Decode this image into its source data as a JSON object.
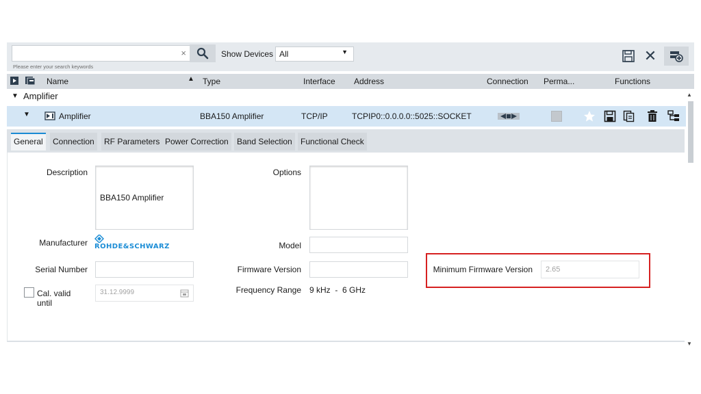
{
  "toolbar": {
    "search_placeholder": "",
    "search_hint": "Please enter your search keywords",
    "clear_glyph": "×",
    "show_devices_label": "Show Devices",
    "show_devices_value": "All",
    "close_glyph": "✕"
  },
  "columns": {
    "name": "Name",
    "type": "Type",
    "interface": "Interface",
    "address": "Address",
    "connection": "Connection",
    "permanent": "Perma...",
    "functions": "Functions"
  },
  "group": {
    "label": "Amplifier"
  },
  "device": {
    "name": "Amplifier",
    "type": "BBA150 Amplifier",
    "interface": "TCP/IP",
    "address": "TCPIP0::0.0.0.0::5025::SOCKET"
  },
  "tabs": [
    {
      "label": "General"
    },
    {
      "label": "Connection"
    },
    {
      "label": "RF Parameters"
    },
    {
      "label": "Power Correction"
    },
    {
      "label": "Band Selection"
    },
    {
      "label": "Functional Check"
    }
  ],
  "general": {
    "description_label": "Description",
    "description_value": "BBA150 Amplifier",
    "options_label": "Options",
    "options_value": "",
    "manufacturer_label": "Manufacturer",
    "manufacturer_logo_text": "ROHDE&SCHWARZ",
    "model_label": "Model",
    "model_value": "",
    "serial_label": "Serial Number",
    "serial_value": "",
    "firmware_label": "Firmware Version",
    "firmware_value": "",
    "min_firmware_label": "Minimum Firmware Version",
    "min_firmware_value": "2.65",
    "cal_label": "Cal. valid until",
    "cal_value": "31.12.9999",
    "freq_label": "Frequency Range",
    "freq_value": "9 kHz  -  6 GHz"
  },
  "colors": {
    "accent": "#1a8ad4",
    "highlight_box": "#d62020",
    "selected_row": "#d4e6f5",
    "toolbar_bg": "#e6eaee"
  }
}
